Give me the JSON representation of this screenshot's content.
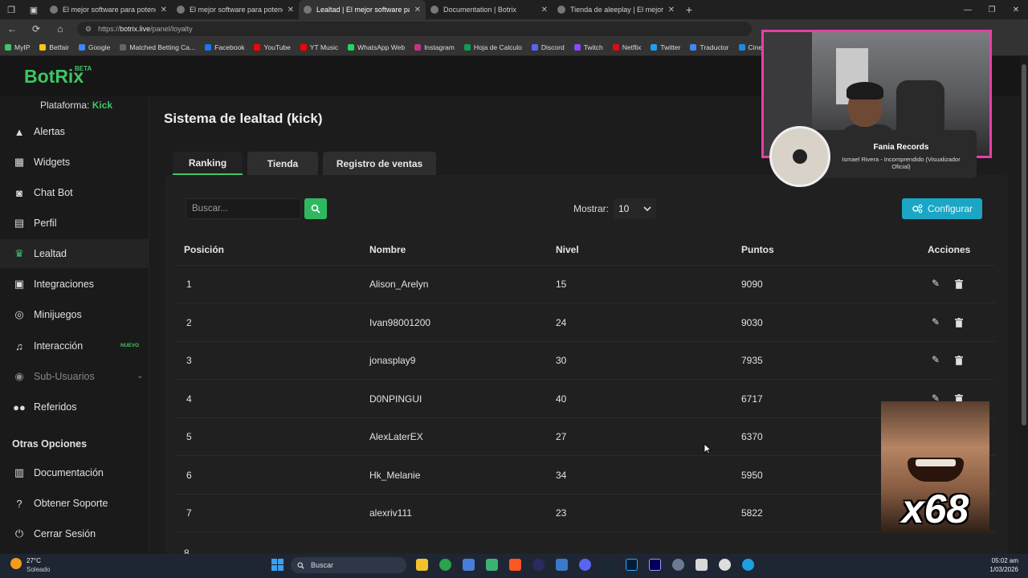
{
  "browser": {
    "tabs": [
      {
        "title": "El mejor software para potenciar",
        "active": false
      },
      {
        "title": "El mejor software para potenciar",
        "active": false
      },
      {
        "title": "Lealtad | El mejor software para p",
        "active": true
      },
      {
        "title": "Documentation | Botrix",
        "active": false
      },
      {
        "title": "Tienda de aleeplay | El mejor softw",
        "active": false
      }
    ],
    "url_prefix": "https://",
    "url_host": "botrix.live",
    "url_path": "/panel/loyalty",
    "bookmarks": [
      {
        "label": "MyIP",
        "color": "#3fc566"
      },
      {
        "label": "Betfair",
        "color": "#f5c518"
      },
      {
        "label": "Google",
        "color": "#4285f4"
      },
      {
        "label": "Matched Betting Ca...",
        "color": "#666666"
      },
      {
        "label": "Facebook",
        "color": "#1877f2"
      },
      {
        "label": "YouTube",
        "color": "#ff0000"
      },
      {
        "label": "YT Music",
        "color": "#ff0000"
      },
      {
        "label": "WhatsApp Web",
        "color": "#25d366"
      },
      {
        "label": "Instagram",
        "color": "#c13584"
      },
      {
        "label": "Hoja de Calculo",
        "color": "#0f9d58"
      },
      {
        "label": "Discord",
        "color": "#5865f2"
      },
      {
        "label": "Twitch",
        "color": "#9146ff"
      },
      {
        "label": "Netflix",
        "color": "#e50914"
      },
      {
        "label": "Twitter",
        "color": "#1da1f2"
      },
      {
        "label": "Traductor",
        "color": "#4285f4"
      },
      {
        "label": "Cineplo",
        "color": "#1e88e5"
      }
    ]
  },
  "app": {
    "logo": "BotRix",
    "logo_badge": "BETA",
    "platform_label": "Plataforma:",
    "platform_value": "Kick",
    "accent": "#3fc566",
    "sidebar": [
      {
        "label": "Alertas",
        "icon": "warning-icon"
      },
      {
        "label": "Widgets",
        "icon": "grid-icon"
      },
      {
        "label": "Chat Bot",
        "icon": "robot-icon"
      },
      {
        "label": "Perfil",
        "icon": "profile-icon"
      },
      {
        "label": "Lealtad",
        "icon": "trophy-icon",
        "active": true
      },
      {
        "label": "Integraciones",
        "icon": "integrations-icon"
      },
      {
        "label": "Minijuegos",
        "icon": "gamepad-icon"
      },
      {
        "label": "Interacción",
        "icon": "music-icon",
        "badge": "NUEVO"
      },
      {
        "label": "Sub-Usuarios",
        "icon": "users-icon",
        "muted": true
      },
      {
        "label": "Referidos",
        "icon": "referrals-icon"
      }
    ],
    "other_section_title": "Otras Opciones",
    "other_items": [
      {
        "label": "Documentación",
        "icon": "docs-icon"
      },
      {
        "label": "Obtener Soporte",
        "icon": "help-icon"
      },
      {
        "label": "Cerrar Sesión",
        "icon": "logout-icon"
      }
    ]
  },
  "main": {
    "title": "Sistema de lealtad (kick)",
    "tabs": [
      "Ranking",
      "Tienda",
      "Registro de ventas"
    ],
    "search_placeholder": "Buscar...",
    "show_label": "Mostrar:",
    "show_value": "10",
    "config_label": "Configurar",
    "columns": [
      "Posición",
      "Nombre",
      "Nivel",
      "Puntos",
      "Acciones"
    ],
    "rows": [
      {
        "pos": "1",
        "name": "Alison_Arelyn",
        "level": "15",
        "points": "9090"
      },
      {
        "pos": "2",
        "name": "Ivan98001200",
        "level": "24",
        "points": "9030"
      },
      {
        "pos": "3",
        "name": "jonasplay9",
        "level": "30",
        "points": "7935"
      },
      {
        "pos": "4",
        "name": "D0NPINGUI",
        "level": "40",
        "points": "6717"
      },
      {
        "pos": "5",
        "name": "AlexLaterEX",
        "level": "27",
        "points": "6370"
      },
      {
        "pos": "6",
        "name": "Hk_Melanie",
        "level": "34",
        "points": "5950"
      },
      {
        "pos": "7",
        "name": "alexriv111",
        "level": "23",
        "points": "5822"
      }
    ]
  },
  "overlays": {
    "music_title": "Fania Records",
    "music_song": "Ismael Rivera - Incomprendido (Visualizador Oficial)",
    "meme_count": "x68"
  },
  "taskbar": {
    "temp": "27°C",
    "weather": "Soleado",
    "search": "Buscar",
    "time": "05:02 am",
    "date": "1/03/2026"
  }
}
